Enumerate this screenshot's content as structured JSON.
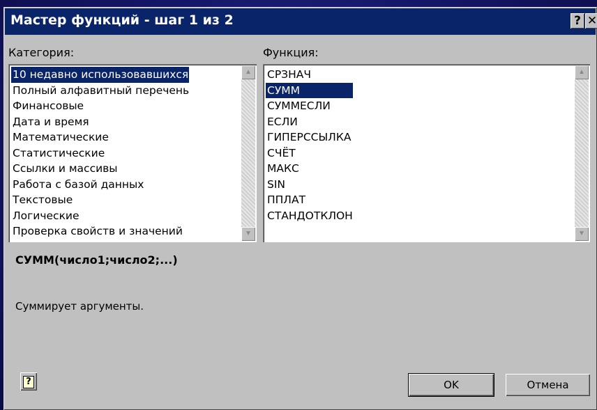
{
  "window": {
    "title": "Мастер функций - шаг 1 из 2",
    "help_button": "?",
    "close_button": "✕"
  },
  "category": {
    "label": "Категория:",
    "selected": "10 недавно использовавшихся",
    "items": [
      "10 недавно использовавшихся",
      "Полный алфавитный перечень",
      "Финансовые",
      "Дата и время",
      "Математические",
      "Статистические",
      "Ссылки и массивы",
      "Работа с базой данных",
      "Текстовые",
      "Логические",
      "Проверка свойств и значений"
    ]
  },
  "function": {
    "label": "Функция:",
    "selected": "СУММ",
    "items": [
      "СРЗНАЧ",
      "СУММ",
      "СУММЕСЛИ",
      "ЕСЛИ",
      "ГИПЕРССЫЛКА",
      "СЧЁТ",
      "МАКС",
      "SIN",
      "ППЛАТ",
      "СТАНДОТКЛОН"
    ]
  },
  "syntax": "СУММ(число1;число2;...)",
  "description": "Суммирует аргументы.",
  "buttons": {
    "help_glyph": "?",
    "ok": "OK",
    "cancel": "Отмена"
  },
  "scrollbar": {
    "up": "▲",
    "down": "▼"
  },
  "colors": {
    "titlebar": "#0a246a",
    "selection": "#0a246a",
    "dialog_face": "#c0c0c0",
    "background": "#161668"
  },
  "icons": {
    "help": "question-mark",
    "close": "close-x",
    "scroll_up": "arrow-up",
    "scroll_down": "arrow-down"
  }
}
